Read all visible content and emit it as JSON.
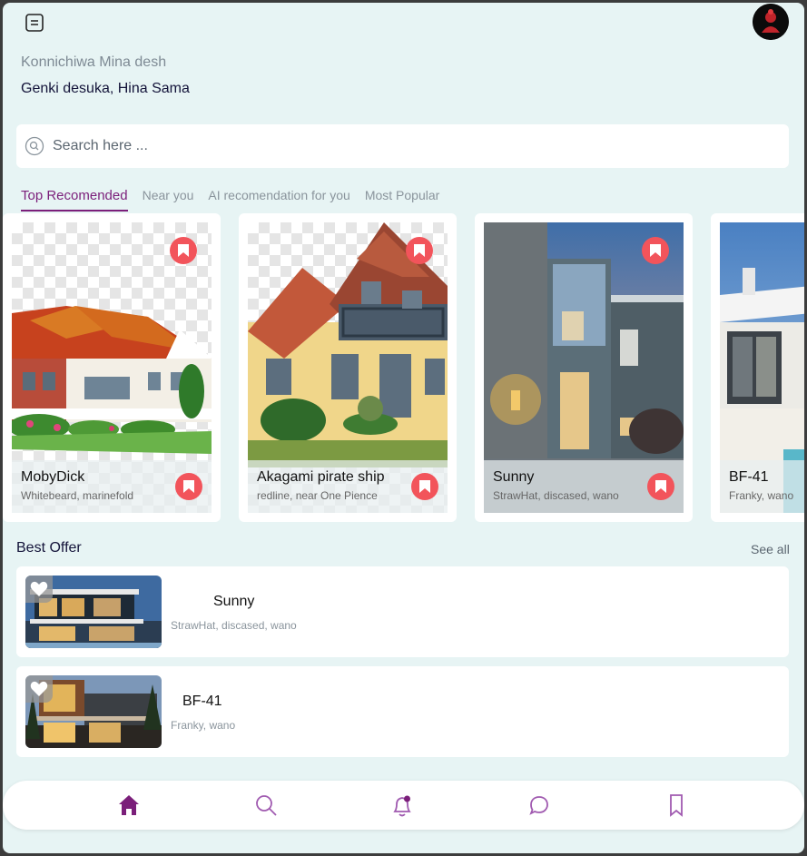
{
  "header": {
    "greeting": "Konnichiwa Mina desh",
    "subgreeting": "Genki desuka, Hina Sama"
  },
  "search": {
    "placeholder": "Search here ..."
  },
  "tabs": [
    {
      "label": "Top Recomended",
      "active": true
    },
    {
      "label": "Near you",
      "active": false
    },
    {
      "label": "AI recomendation for you",
      "active": false
    },
    {
      "label": "Most Popular",
      "active": false
    }
  ],
  "cards": [
    {
      "title": "MobyDick",
      "subtitle": "Whitebeard, marinefold"
    },
    {
      "title": "Akagami pirate ship",
      "subtitle": "redline, near One Pience"
    },
    {
      "title": "Sunny",
      "subtitle": "StrawHat, discased, wano"
    },
    {
      "title": "BF-41",
      "subtitle": "Franky, wano"
    }
  ],
  "best_offer": {
    "title": "Best Offer",
    "see_all": "See all",
    "items": [
      {
        "title": "Sunny",
        "subtitle": "StrawHat, discased, wano"
      },
      {
        "title": "BF-41",
        "subtitle": "Franky, wano"
      }
    ]
  },
  "nav": [
    {
      "icon": "home-icon",
      "active": true
    },
    {
      "icon": "search-icon",
      "active": false
    },
    {
      "icon": "bell-icon",
      "active": false
    },
    {
      "icon": "chat-icon",
      "active": false
    },
    {
      "icon": "bookmark-icon",
      "active": false
    }
  ],
  "colors": {
    "accent": "#7b1f7a",
    "bookmark": "#f2545b",
    "background": "#e7f4f4"
  }
}
